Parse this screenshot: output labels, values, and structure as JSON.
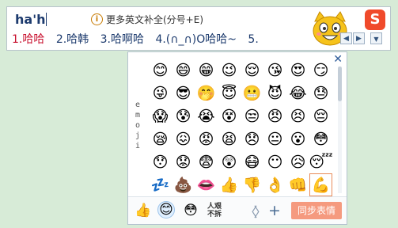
{
  "ime": {
    "pinyin": "ha'h",
    "hint_text": "更多英文补全(分号+E)",
    "info_icon_glyph": "i",
    "logo_glyph": "S",
    "candidates": [
      {
        "label": "1.哈哈"
      },
      {
        "label": "2.哈韩"
      },
      {
        "label": "3.哈啊哈"
      },
      {
        "label": "4.(∩_∩)O哈哈~"
      },
      {
        "label": "5."
      }
    ],
    "pager_prev": "◀",
    "pager_next": "▶",
    "menu_glyph": "▼"
  },
  "emoji_panel": {
    "close_glyph": "✕",
    "side_label": "emoji",
    "cells": [
      {
        "glyph": "😊",
        "icon": "smile-icon"
      },
      {
        "glyph": "😄",
        "icon": "grin-icon"
      },
      {
        "glyph": "😁",
        "icon": "beam-icon"
      },
      {
        "glyph": "😉",
        "icon": "wink-icon"
      },
      {
        "glyph": "😌",
        "icon": "relieved-icon"
      },
      {
        "glyph": "😘",
        "icon": "kiss-icon"
      },
      {
        "glyph": "😍",
        "icon": "heart-eyes-icon"
      },
      {
        "glyph": "😏",
        "icon": "smirk-icon"
      },
      {
        "glyph": "😜",
        "icon": "tongue-wink-icon"
      },
      {
        "glyph": "😎",
        "icon": "sunglasses-icon"
      },
      {
        "glyph": "🤭",
        "icon": "hand-over-mouth-icon"
      },
      {
        "glyph": "😇",
        "icon": "halo-icon"
      },
      {
        "glyph": "😬",
        "icon": "grimace-icon"
      },
      {
        "glyph": "😈",
        "icon": "devil-icon"
      },
      {
        "glyph": "😂",
        "icon": "tears-of-joy-icon"
      },
      {
        "glyph": "😓",
        "icon": "sweat-icon"
      },
      {
        "glyph": "😱",
        "icon": "scream-icon"
      },
      {
        "glyph": "😰",
        "icon": "anxious-icon"
      },
      {
        "glyph": "😭",
        "icon": "crying-icon"
      },
      {
        "glyph": "😵",
        "icon": "dizzy-face-icon"
      },
      {
        "glyph": "😒",
        "icon": "unamused-icon"
      },
      {
        "glyph": "😠",
        "icon": "angry-icon"
      },
      {
        "glyph": "😣",
        "icon": "persevere-icon"
      },
      {
        "glyph": "😔",
        "icon": "pensive-icon"
      },
      {
        "glyph": "😪",
        "icon": "sleepy-icon"
      },
      {
        "glyph": "😖",
        "icon": "confounded-icon"
      },
      {
        "glyph": "😡",
        "icon": "rage-icon"
      },
      {
        "glyph": "😫",
        "icon": "tired-icon"
      },
      {
        "glyph": "😞",
        "icon": "disappointed-icon"
      },
      {
        "glyph": "😐",
        "icon": "neutral-icon"
      },
      {
        "glyph": "😮",
        "icon": "open-mouth-icon"
      },
      {
        "glyph": "😳",
        "icon": "flushed-icon"
      },
      {
        "glyph": "😯",
        "icon": "hushed-icon"
      },
      {
        "glyph": "😟",
        "icon": "worried-icon"
      },
      {
        "glyph": "😨",
        "icon": "fearful-icon"
      },
      {
        "glyph": "😲",
        "icon": "astonished-icon"
      },
      {
        "glyph": "😷",
        "icon": "mask-icon"
      },
      {
        "glyph": "😶",
        "icon": "no-mouth-icon"
      },
      {
        "glyph": "😥",
        "icon": "sad-relieved-icon"
      },
      {
        "glyph": "😴",
        "icon": "sleeping-icon"
      },
      {
        "glyph": "💤",
        "icon": "zzz-icon"
      },
      {
        "glyph": "💩",
        "icon": "poop-icon"
      },
      {
        "glyph": "👄",
        "icon": "lips-icon"
      },
      {
        "glyph": "👍",
        "icon": "thumbs-up-icon"
      },
      {
        "glyph": "👎",
        "icon": "thumbs-down-icon"
      },
      {
        "glyph": "👌",
        "icon": "ok-hand-icon"
      },
      {
        "glyph": "👊",
        "icon": "fist-icon"
      },
      {
        "glyph": "💪",
        "icon": "flexed-biceps-icon"
      }
    ],
    "selected_index": 47,
    "bottom": {
      "tab1_glyph": "👍",
      "tab2_glyph": "😊",
      "tab3_glyph": "😳",
      "tab4_text": "人艰不拆",
      "prev_glyph": "〈",
      "next_glyph": "〉",
      "plus_glyph": "+",
      "sync_label": "同步表情"
    }
  }
}
